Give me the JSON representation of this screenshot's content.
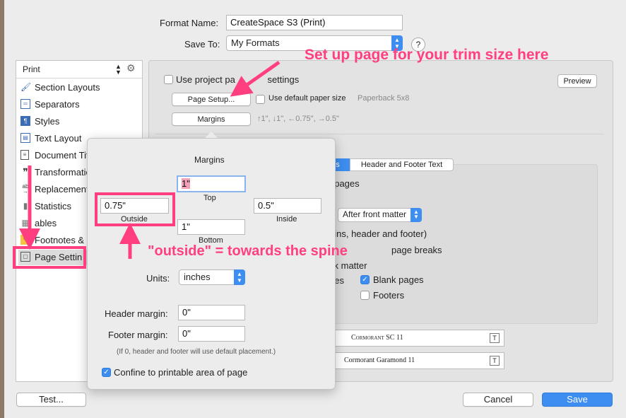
{
  "header": {
    "format_name_label": "Format Name:",
    "format_name_value": "CreateSpace S3 (Print)",
    "save_to_label": "Save To:",
    "save_to_value": "My Formats",
    "help_label": "?"
  },
  "sidebar": {
    "selector_label": "Print",
    "items": [
      {
        "label": "Section Layouts"
      },
      {
        "label": "Separators"
      },
      {
        "label": "Styles"
      },
      {
        "label": "Text Layout"
      },
      {
        "label": "Document Tit"
      },
      {
        "label": "Transformatio"
      },
      {
        "label": "Replacement"
      },
      {
        "label": "Statistics"
      },
      {
        "label": "ables"
      },
      {
        "label": "Footnotes & C"
      },
      {
        "label": "Page Settin"
      }
    ]
  },
  "main": {
    "use_project_label": "Use project pa",
    "use_project_label_tail": "settings",
    "preview_label": "Preview",
    "page_setup_label": "Page Setup...",
    "use_default_paper_label": "Use default paper size",
    "paper_name": "Paperback 5x8",
    "margins_button_label": "Margins",
    "margins_summary": "↑1\", ↓1\", ←0.75\", →0.5\"",
    "tabs": [
      {
        "label": "ns"
      },
      {
        "label": "Header and Footer Text"
      }
    ],
    "t_pages_text": "t pages",
    "after_front_matter": "After front matter",
    "gins_text": "gins, header and footer)",
    "page_breaks_text": "page breaks",
    "e_text": "e",
    "ck_matter_text": "ck matter",
    "ges_text": "ges",
    "blank_pages_label": "Blank pages",
    "footers_label": "Footers",
    "font_1": "Cormorant SC 11",
    "font_2": "Cormorant Garamond 11",
    "font_icon": "T"
  },
  "popover": {
    "title": "Margins",
    "top_value": "1\"",
    "top_label": "Top",
    "outside_value": "0.75\"",
    "outside_label": "Outside",
    "inside_value": "0.5\"",
    "inside_label": "Inside",
    "bottom_value": "1\"",
    "bottom_label": "Bottom",
    "units_label": "Units:",
    "units_value": "inches",
    "header_margin_label": "Header margin:",
    "header_margin_value": "0\"",
    "footer_margin_label": "Footer margin:",
    "footer_margin_value": "0\"",
    "hint": "(If 0, header and footer will use default placement.)",
    "confine_label": "Confine to printable area of page"
  },
  "annotations": {
    "trim_note": "Set up page for your trim size here",
    "outside_note": "\"outside\" = towards the spine"
  },
  "footer": {
    "test_label": "Test...",
    "cancel_label": "Cancel",
    "save_label": "Save"
  },
  "colors": {
    "accent": "#3d8ef0",
    "annotation": "#ff3f7f"
  }
}
